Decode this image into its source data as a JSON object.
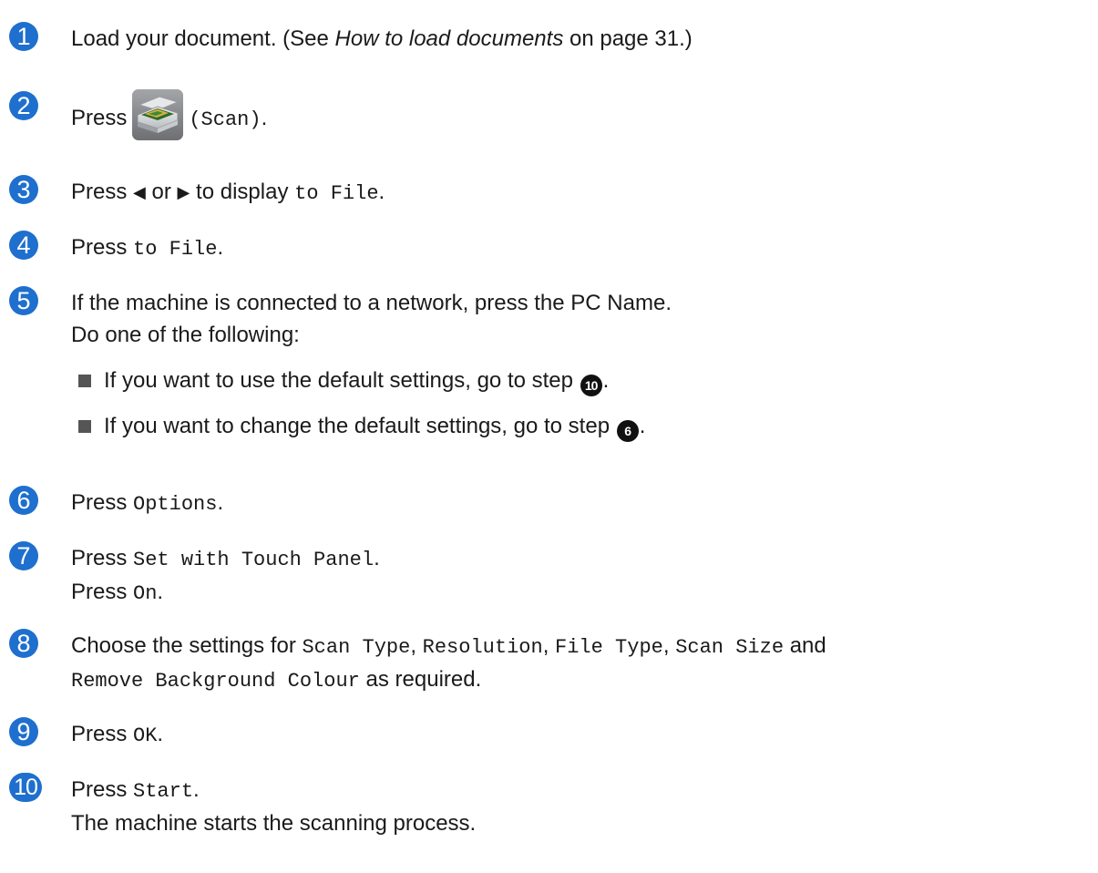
{
  "steps": [
    {
      "number": "1",
      "parts": {
        "a": "Load your document. (See ",
        "b": "How to load documents",
        "c": " on page 31.)"
      }
    },
    {
      "number": "2",
      "parts": {
        "a": "Press",
        "icon": "scanner-icon",
        "b": "(Scan)",
        "c": "."
      }
    },
    {
      "number": "3",
      "parts": {
        "a": "Press ",
        "left_arrow": "◀",
        "b": " or ",
        "right_arrow": "▶",
        "c": " to display ",
        "d": "to File",
        "e": "."
      }
    },
    {
      "number": "4",
      "parts": {
        "a": "Press ",
        "b": "to File",
        "c": "."
      }
    },
    {
      "number": "5",
      "lines": [
        "If the machine is connected to a network, press the PC Name.",
        "Do one of the following:"
      ],
      "bullets": [
        {
          "text": "If you want to use the default settings, go to step ",
          "ref": "10",
          "end": "."
        },
        {
          "text": "If you want to change the default settings, go to step ",
          "ref": "6",
          "end": "."
        }
      ]
    },
    {
      "number": "6",
      "parts": {
        "a": "Press ",
        "b": "Options",
        "c": "."
      }
    },
    {
      "number": "7",
      "line1": {
        "a": "Press ",
        "b": "Set with Touch Panel",
        "c": "."
      },
      "line2": {
        "a": "Press ",
        "b": "On",
        "c": "."
      }
    },
    {
      "number": "8",
      "parts": {
        "a": "Choose the settings for ",
        "b": "Scan Type",
        "c": ", ",
        "d": "Resolution",
        "e": ", ",
        "f": "File Type",
        "g": ", ",
        "h": "Scan Size",
        "i": " and",
        "j": "Remove Background Colour",
        "k": " as required."
      }
    },
    {
      "number": "9",
      "parts": {
        "a": "Press ",
        "b": "OK",
        "c": "."
      }
    },
    {
      "number": "10",
      "line1": {
        "a": "Press ",
        "b": "Start",
        "c": "."
      },
      "line2": "The machine starts the scanning process."
    }
  ],
  "colors": {
    "step_badge": "#1e6fce",
    "text": "#1a1a1a"
  }
}
